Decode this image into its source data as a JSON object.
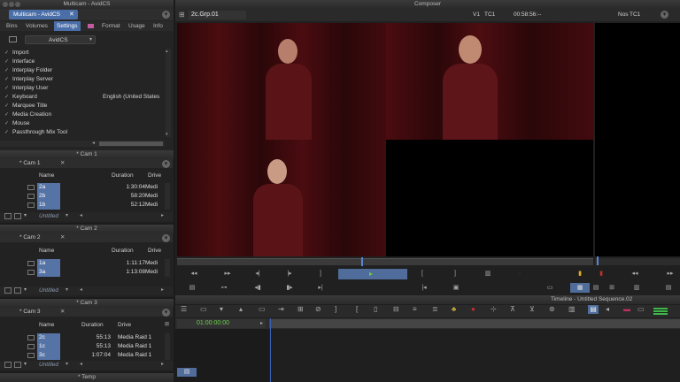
{
  "project_window": {
    "title": "Multicam - AvidCS",
    "subtitle": "Multicam - AvidCS",
    "tabs": [
      "Bins",
      "Volumes",
      "Settings",
      "",
      "Format",
      "Usage",
      "Info"
    ],
    "active_tab": "Settings",
    "settings_dropdown": "AvidCS",
    "settings": [
      {
        "name": "Import",
        "value": ""
      },
      {
        "name": "Interface",
        "value": ""
      },
      {
        "name": "Interplay Folder",
        "value": ""
      },
      {
        "name": "Interplay Server",
        "value": ""
      },
      {
        "name": "Interplay User",
        "value": ""
      },
      {
        "name": "Keyboard",
        "value": "English (United States"
      },
      {
        "name": "Marquee Title",
        "value": ""
      },
      {
        "name": "Media Creation",
        "value": ""
      },
      {
        "name": "Mouse",
        "value": ""
      },
      {
        "name": "Passthrough Mix Tool",
        "value": ""
      }
    ]
  },
  "bins": [
    {
      "window_title": "Cam 1",
      "tab": "Cam 1",
      "columns": [
        "Name",
        "Duration",
        "Drive"
      ],
      "rows": [
        {
          "name": "2a",
          "duration": "1:30:04",
          "drive": "Medi"
        },
        {
          "name": "2b",
          "duration": "58:20",
          "drive": "Medi"
        },
        {
          "name": "1b",
          "duration": "52:12",
          "drive": "Medi"
        }
      ],
      "footer": "Untitled"
    },
    {
      "window_title": "Cam 2",
      "tab": "Cam 2",
      "columns": [
        "Name",
        "Duration",
        "Drive"
      ],
      "rows": [
        {
          "name": "1a",
          "duration": "1:11:17",
          "drive": "Medi"
        },
        {
          "name": "3a",
          "duration": "1:13:08",
          "drive": "Medi"
        }
      ],
      "footer": "Untitled"
    },
    {
      "window_title": "Cam 3",
      "tab": "Cam 3",
      "columns": [
        "Name",
        "Duration",
        "Drive"
      ],
      "rows": [
        {
          "name": "2c",
          "duration": "55:13",
          "drive": "Media Raid 1"
        },
        {
          "name": "1c",
          "duration": "55:13",
          "drive": "Media Raid 1"
        },
        {
          "name": "3c",
          "duration": "1:07:04",
          "drive": "Media Raid 1"
        }
      ],
      "footer": "Untitled"
    },
    {
      "window_title": "Temp",
      "tab": "Temp"
    }
  ],
  "composer": {
    "title": "Composer",
    "clip_name": "2c.Grp.01",
    "track_label": "V1",
    "tc_label": "TC1",
    "timecode": "00:58:56:--",
    "right_track": "Nos",
    "right_tc_label": "TC1"
  },
  "timeline": {
    "title": "Timeline - Untitled Sequence.02",
    "timecode": "01:00:00:00"
  },
  "colors": {
    "accent": "#4a6ea8",
    "bin_selection": "#5673a6",
    "timecode_green": "#6ad04a",
    "curtain": "#3a0a0c"
  }
}
